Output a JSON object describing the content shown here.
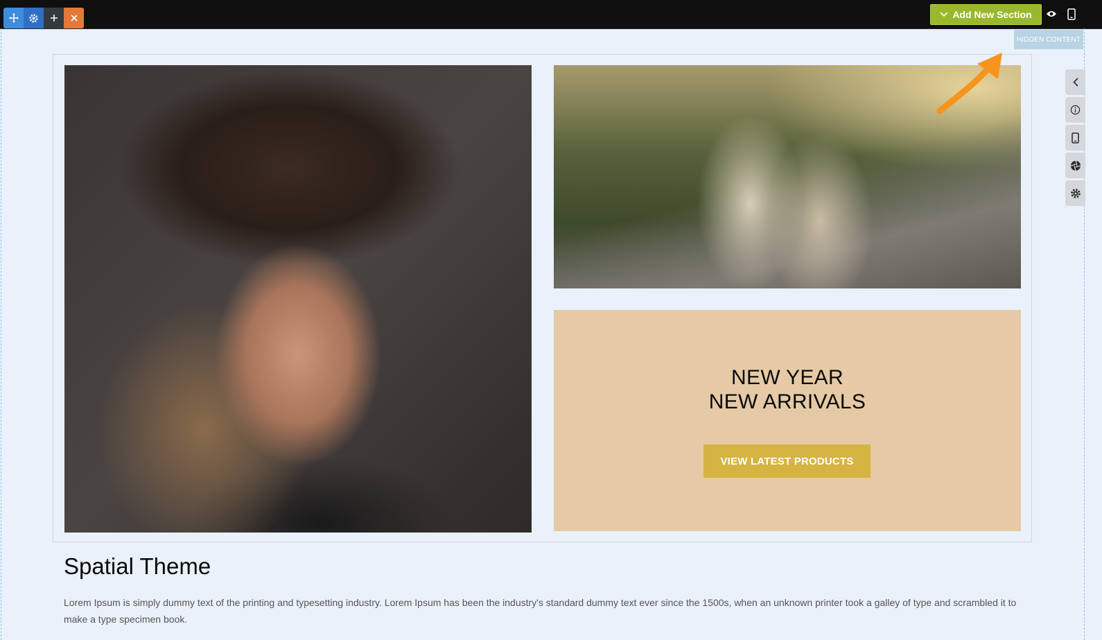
{
  "toolbar": {
    "tools": [
      {
        "icon": "move-icon",
        "label": "✥"
      },
      {
        "icon": "gear-icon",
        "label": "⚙"
      },
      {
        "icon": "plus-icon",
        "label": "+"
      },
      {
        "icon": "close-icon",
        "label": "×"
      }
    ],
    "add_section_label": "Add New Section",
    "preview_icon": "eye-icon",
    "mobile_icon": "mobile-icon"
  },
  "hidden_tag": "HIDDEN CONTENT",
  "promo": {
    "title_line1": "NEW YEAR",
    "title_line2": "NEW ARRIVALS",
    "cta_label": "VIEW LATEST PRODUCTS"
  },
  "side_toolbar": [
    "chevron-left-icon",
    "info-icon",
    "mobile-icon",
    "aperture-icon",
    "gear-icon"
  ],
  "content": {
    "title": "Spatial Theme",
    "body": "Lorem Ipsum is simply dummy text of the printing and typesetting industry. Lorem Ipsum has been the industry's standard dummy text ever since the 1500s, when an unknown printer took a galley of type and scrambled it to make a type specimen book."
  },
  "colors": {
    "add_section": "#9ab82c",
    "promo_bg": "#e5caa5",
    "cta": "#d6b443",
    "arrow": "#f7941d"
  }
}
